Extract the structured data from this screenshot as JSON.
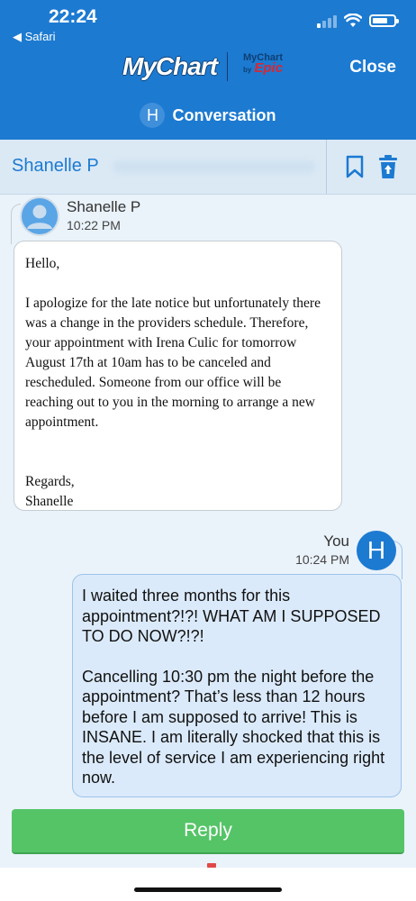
{
  "status_bar": {
    "time": "22:24",
    "back_app": "◀ Safari"
  },
  "header": {
    "logo_text": "MyChart",
    "logo_sub_top": "MyChart",
    "logo_sub_by": "by",
    "logo_sub_brand": "Epic",
    "close_label": "Close",
    "conversation_initial": "H",
    "conversation_title": "Conversation"
  },
  "subheader": {
    "name": "Shanelle P",
    "icons": [
      "bookmark-icon",
      "trash-icon"
    ]
  },
  "message_1": {
    "sender": "Shanelle P",
    "time": "10:22 PM",
    "greeting": "Hello,",
    "body": "I apologize for the late notice but unfortunately there was a change in the providers schedule. Therefore, your appointment with Irena Culic for tomorrow August 17th at 10am has to be canceled and rescheduled. Someone from our office will be reaching out to you in the morning to arrange a new appointment.",
    "closing": "Regards,",
    "signature": "Shanelle"
  },
  "message_2": {
    "sender": "You",
    "time": "10:24 PM",
    "avatar_initial": "H",
    "para_1": "I waited three months for this appointment?!?! WHAT AM I SUPPOSED TO DO NOW?!?!",
    "para_2": "Cancelling 10:30 pm the night before the appointment? That’s less than 12 hours before I am supposed to arrive! This is INSANE. I am literally shocked that this is the level of service I am experiencing right now."
  },
  "reply_label": "Reply",
  "colors": {
    "header_blue": "#1c7ad1",
    "reply_green": "#55c467",
    "your_bubble": "#dbeafa"
  }
}
